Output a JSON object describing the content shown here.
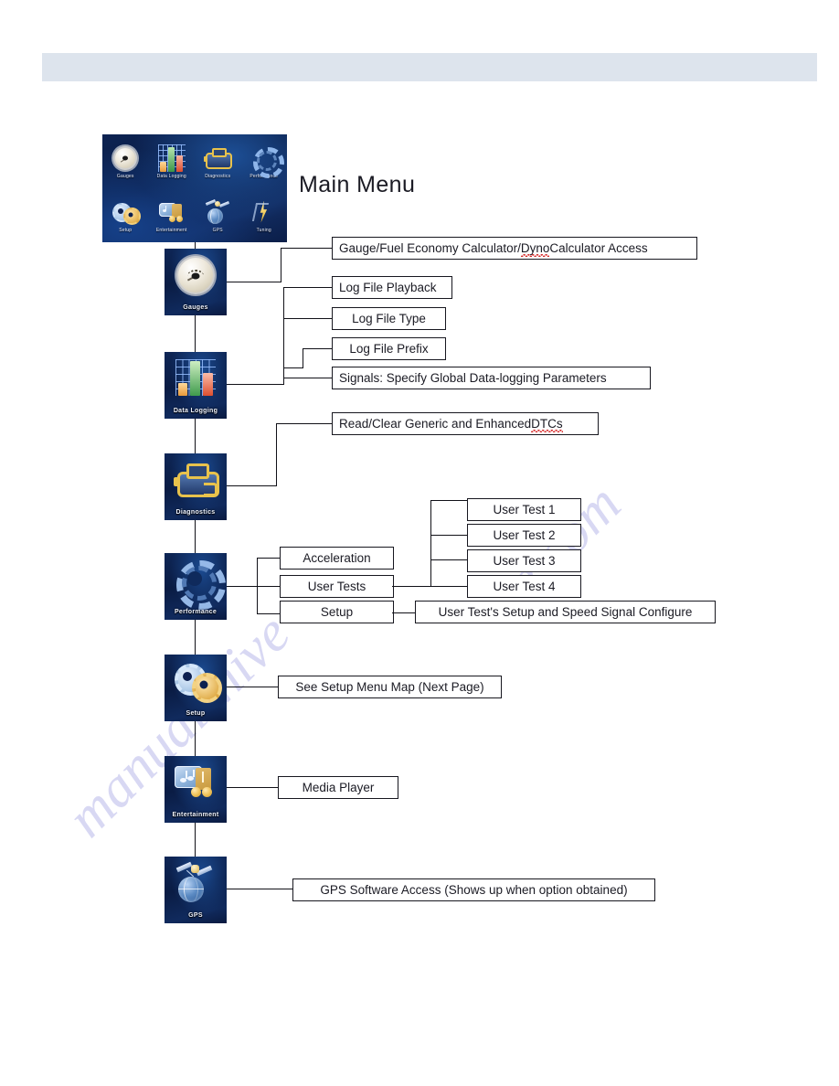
{
  "document": {
    "title_heading": "Main Menu"
  },
  "main_menu_screenshot": {
    "name": "main-menu-device-screenshot",
    "items": [
      {
        "label": "Gauges",
        "icon": "gauge-icon"
      },
      {
        "label": "Data Logging",
        "icon": "bar-chart-icon"
      },
      {
        "label": "Diagnostics",
        "icon": "engine-icon"
      },
      {
        "label": "Performance",
        "icon": "circular-arrows-icon"
      },
      {
        "label": "Setup",
        "icon": "gears-icon"
      },
      {
        "label": "Entertainment",
        "icon": "music-notes-icon"
      },
      {
        "label": "GPS",
        "icon": "satellite-globe-icon"
      },
      {
        "label": "Tuning",
        "icon": "lightning-bolt-icon"
      }
    ]
  },
  "menu_tiles": [
    {
      "label": "Gauges",
      "icon": "gauge-icon"
    },
    {
      "label": "Data Logging",
      "icon": "bar-chart-icon"
    },
    {
      "label": "Diagnostics",
      "icon": "engine-icon"
    },
    {
      "label": "Performance",
      "icon": "circular-arrows-icon"
    },
    {
      "label": "Setup",
      "icon": "gears-icon"
    },
    {
      "label": "Entertainment",
      "icon": "music-notes-icon"
    },
    {
      "label": "GPS",
      "icon": "satellite-globe-icon"
    }
  ],
  "boxes": {
    "gauges_access": "Gauge/Fuel Economy Calculator/",
    "gauges_access_misspelled": "Dyno",
    "gauges_access_tail": " Calculator Access",
    "log_file_playback": "Log File Playback",
    "log_file_type": "Log File Type",
    "log_file_prefix": "Log File Prefix",
    "signals": "Signals: Specify Global Data-logging Parameters",
    "dtc_head": "Read/Clear Generic and Enhanced ",
    "dtc_misspelled": "DTCs",
    "acceleration": "Acceleration",
    "user_tests": "User Tests",
    "performance_setup": "Setup",
    "user_test_1": "User Test 1",
    "user_test_2": "User Test 2",
    "user_test_3": "User Test 3",
    "user_test_4": "User Test 4",
    "user_test_setup": "User Test's Setup and Speed Signal Configure",
    "setup_menu_map": "See Setup Menu Map (Next Page)",
    "media_player": "Media Player",
    "gps_access": "GPS Software Access (Shows up when option obtained)"
  },
  "watermark": {
    "line1": "manualshive",
    "line2": "e.com"
  },
  "colors": {
    "header_band": "#dde4ed",
    "tile_navy": "#0d2352",
    "line": "#111118",
    "text": "#1b1b24",
    "spellcheck_red": "#d62b2b",
    "watermark": "#ccccf0"
  }
}
